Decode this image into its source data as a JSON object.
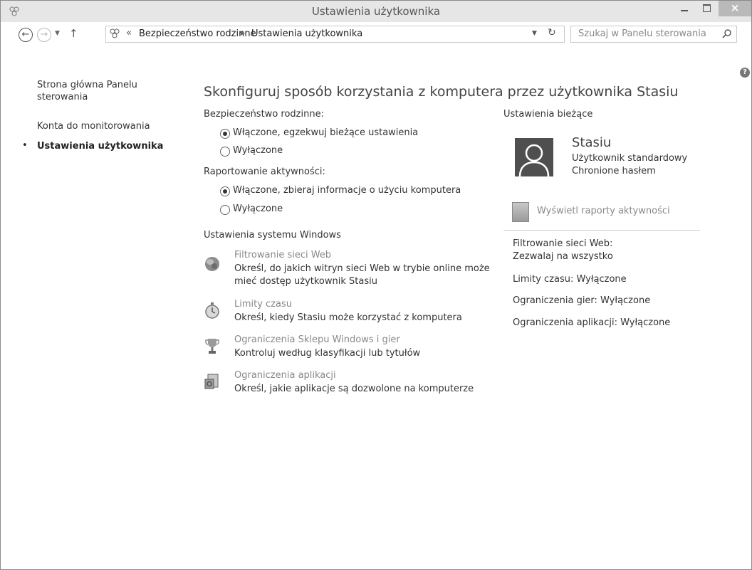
{
  "window": {
    "title": "Ustawienia użytkownika"
  },
  "nav": {
    "breadcrumb_prefix": "«",
    "crumbs": [
      "Bezpieczeństwo rodzinne",
      "Ustawienia użytkownika"
    ],
    "search_placeholder": "Szukaj w Panelu sterowania"
  },
  "sidebar": {
    "home": "Strona główna Panelu sterowania",
    "items": [
      "Konta do monitorowania",
      "Ustawienia użytkownika"
    ],
    "current_bullet": "•"
  },
  "main": {
    "heading": "Skonfiguruj sposób korzystania z komputera przez użytkownika Stasiu",
    "family_safety": {
      "label": "Bezpieczeństwo rodzinne:",
      "options": [
        "Włączone, egzekwuj bieżące ustawienia",
        "Wyłączone"
      ],
      "selected": 0
    },
    "activity_reporting": {
      "label": "Raportowanie aktywności:",
      "options": [
        "Włączone, zbieraj informacje o użyciu komputera",
        "Wyłączone"
      ],
      "selected": 0
    },
    "windows_settings_label": "Ustawienia systemu Windows",
    "settings": [
      {
        "title": "Filtrowanie sieci Web",
        "desc": "Określ, do jakich witryn sieci Web w trybie online może mieć dostęp użytkownik Stasiu",
        "icon": "globe-icon"
      },
      {
        "title": "Limity czasu",
        "desc": "Określ, kiedy Stasiu może korzystać z komputera",
        "icon": "stopwatch-icon"
      },
      {
        "title": "Ograniczenia Sklepu Windows i gier",
        "desc": "Kontroluj według klasyfikacji lub tytułów",
        "icon": "trophy-icon"
      },
      {
        "title": "Ograniczenia aplikacji",
        "desc": "Określ, jakie aplikacje są dozwolone na komputerze",
        "icon": "app-restriction-icon"
      }
    ]
  },
  "current_settings": {
    "label": "Ustawienia bieżące",
    "user_name": "Stasiu",
    "user_type": "Użytkownik standardowy",
    "user_password": "Chronione hasłem",
    "report_link": "Wyświetl raporty aktywności",
    "web_filter_label": "Filtrowanie sieci Web:",
    "web_filter_value": "Zezwalaj na wszystko",
    "time_limits": "Limity czasu: Wyłączone",
    "game_limits": "Ograniczenia gier: Wyłączone",
    "app_limits": "Ograniczenia aplikacji: Wyłączone"
  },
  "colors": {
    "titlebar": "#e6e6e6",
    "close_button": "#b9b9b9",
    "link_gray": "#888888"
  }
}
